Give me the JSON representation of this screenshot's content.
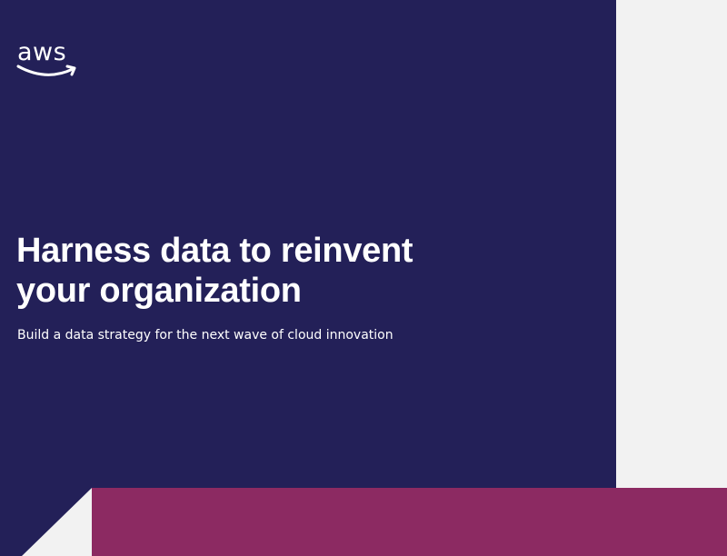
{
  "brand": {
    "logo_text": "aws",
    "colors": {
      "navy": "#232058",
      "magenta": "#8c2a62",
      "light_gray": "#f2f2f2",
      "white": "#ffffff"
    },
    "logo_icon": "aws-smile-arrow-icon"
  },
  "cover": {
    "title_line1": "Harness data to reinvent",
    "title_line2": "your organization",
    "subtitle": "Build a data strategy for the next wave of cloud innovation"
  }
}
